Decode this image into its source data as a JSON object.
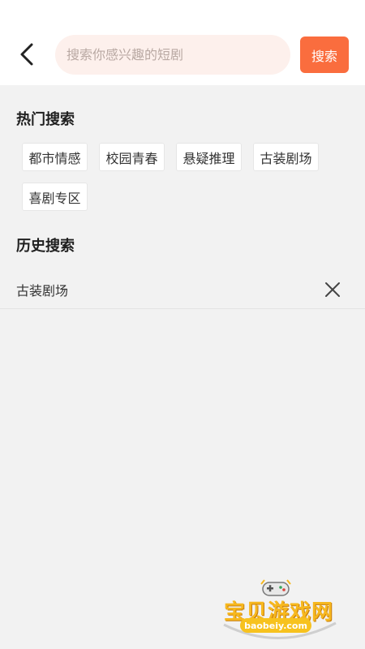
{
  "header": {
    "search_placeholder": "搜索你感兴趣的短剧",
    "search_button": "搜索",
    "back_icon": "chevron-left-icon"
  },
  "hot_search": {
    "title": "热门搜索",
    "tags": [
      "都市情感",
      "校园青春",
      "悬疑推理",
      "古装剧场",
      "喜剧专区"
    ]
  },
  "history": {
    "title": "历史搜索",
    "items": [
      {
        "text": "古装剧场",
        "delete_icon": "close-icon"
      }
    ]
  },
  "watermark": {
    "name": "宝贝游戏网",
    "url": "baobeiy.com"
  },
  "colors": {
    "accent": "#fa6d3e",
    "search_bg": "#fdf0ec",
    "page_bg": "#f2f2f2"
  }
}
